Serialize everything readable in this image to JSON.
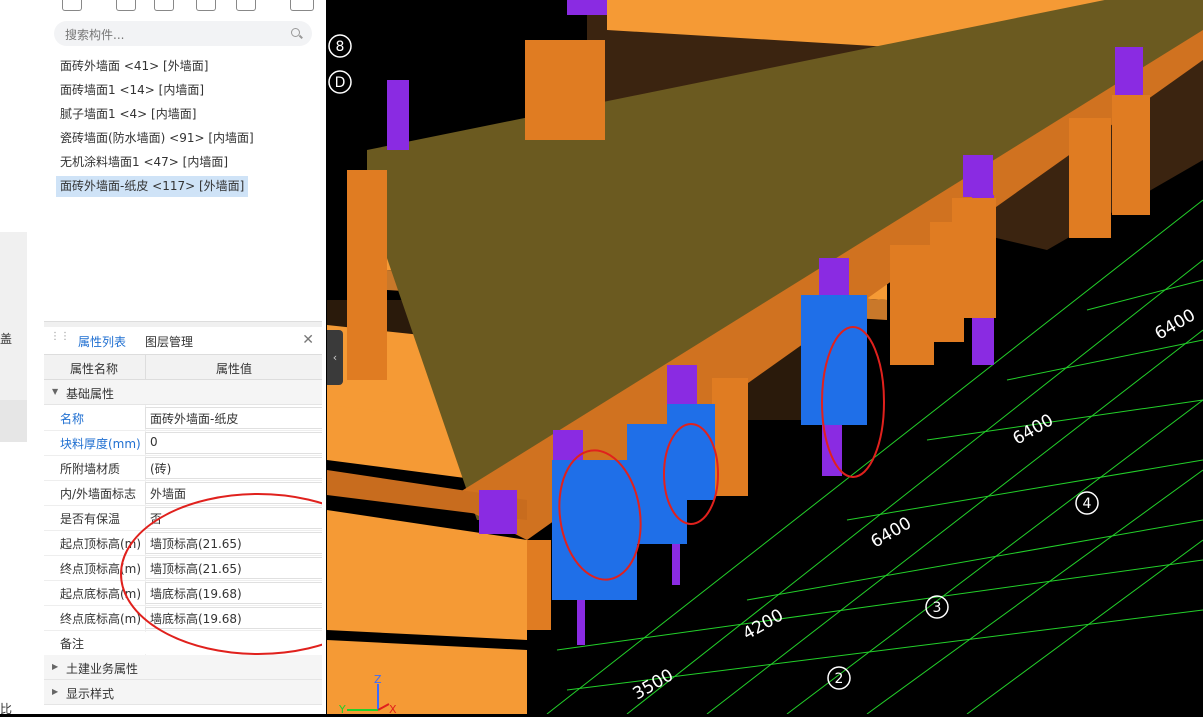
{
  "left_strip": {
    "char1": "盖",
    "char2": "比"
  },
  "search": {
    "placeholder": "搜索构件..."
  },
  "components": [
    {
      "label": "面砖外墙面 <41> [外墙面]"
    },
    {
      "label": "面砖墙面1 <14> [内墙面]"
    },
    {
      "label": "腻子墙面1 <4> [内墙面]"
    },
    {
      "label": "瓷砖墙面(防水墙面) <91> [内墙面]"
    },
    {
      "label": "无机涂料墙面1 <47> [内墙面]"
    },
    {
      "label": "面砖外墙面-纸皮 <117> [外墙面]"
    }
  ],
  "props_panel": {
    "tabs": [
      "属性列表",
      "图层管理"
    ],
    "col_name": "属性名称",
    "col_value": "属性值",
    "group_basic": "基础属性",
    "rows": [
      {
        "name": "名称",
        "value": "面砖外墙面-纸皮"
      },
      {
        "name": "块料厚度(mm)",
        "value": "0"
      },
      {
        "name": "所附墙材质",
        "value": "(砖)"
      },
      {
        "name": "内/外墙面标志",
        "value": "外墙面"
      },
      {
        "name": "是否有保温",
        "value": "否"
      },
      {
        "name": "起点顶标高(m)",
        "value": "墙顶标高(21.65)"
      },
      {
        "name": "终点顶标高(m)",
        "value": "墙顶标高(21.65)"
      },
      {
        "name": "起点底标高(m)",
        "value": "墙底标高(19.68)"
      },
      {
        "name": "终点底标高(m)",
        "value": "墙底标高(19.68)"
      },
      {
        "name": "备注",
        "value": ""
      }
    ],
    "group_civil": "土建业务属性",
    "group_display": "显示样式"
  },
  "viewport": {
    "axis_labels": [
      "8",
      "D"
    ],
    "dims": [
      "6400",
      "6400",
      "6400",
      "4200",
      "3500"
    ],
    "grid_nums": [
      "4",
      "3",
      "2"
    ],
    "axis": {
      "z": "Z",
      "y": "Y",
      "x": "X"
    },
    "colors": {
      "beam": "#f59a35",
      "column": "#8a2be2",
      "wall_sel": "#1f6fe8",
      "grid": "#23d02a",
      "annot": "#e0211d"
    }
  }
}
